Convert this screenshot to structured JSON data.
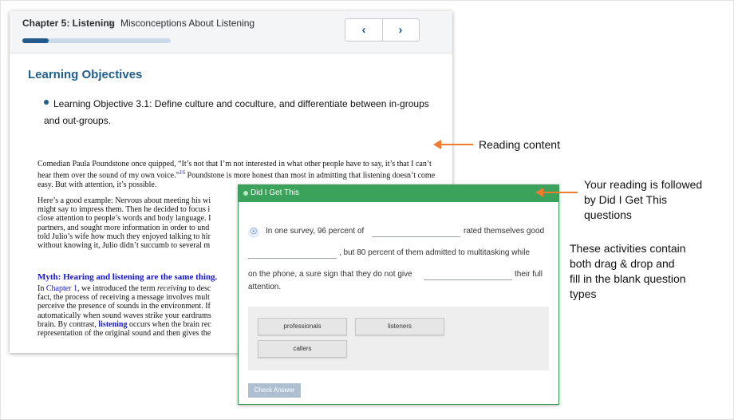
{
  "reader": {
    "chapter": "Chapter 5: Listening",
    "separator": ">",
    "section": "Misconceptions About Listening",
    "progress": 0.18,
    "prev_icon": "chevron-left-icon",
    "next_icon": "chevron-right-icon",
    "prev_glyph": "‹",
    "next_glyph": "›",
    "objectives_title": "Learning Objectives",
    "objective": "Learning Objective 3.1: Define culture and coculture, and differentiate between in-groups and out-groups.",
    "p1_a": "Comedian Paula Poundstone once quipped, “It’s not that I’m not interested in what other people have to say, it’s that I can’t hear them over the sound of my own voice.”",
    "p1_sup": "16",
    "p1_b": " Poundstone is more honest than most in admitting that listening doesn’t come easy. But with attention, it’s possible.",
    "p2": "Here’s a good example: Nervous about meeting his wi\nmight say to impress them. Then he decided to focus i\nclose attention to people’s words and body language. I\npartners, and sought more information in order to und\ntold Julio’s wife how much they enjoyed talking to hir\nwithout knowing it, Julio didn’t succumb to several m",
    "myth": "Myth: Hearing and listening are the same thing.",
    "p3_a": "In ",
    "p3_link": "Chapter 1",
    "p3_b": ", we introduced the term ",
    "p3_em": "receiving",
    "p3_c": " to desc\nfact, the process of receiving a message involves mult\nperceive the presence of sounds in the environment. If\nautomatically when sound waves strike your eardrums\nbrain. By contrast, ",
    "p3_bold": "listening",
    "p3_d": " occurs when the brain rec\nrepresentation of the original sound and then gives the"
  },
  "quiz": {
    "title": "Did I Get This",
    "accessibility_icon": "accessibility-icon",
    "seg1": "In one survey, 96 percent of",
    "seg2": "rated themselves good",
    "seg3": ", but 80 percent of them admitted to multitasking while",
    "seg4": "on the phone, a sure sign that they do not give",
    "seg5": "their full",
    "seg6": "attention.",
    "tiles": [
      "professionals",
      "listeners",
      "callers"
    ],
    "check_label": "Check Answer"
  },
  "annotations": {
    "reading": "Reading content",
    "dig": "Your reading is followed\nby Did I Get This\nquestions",
    "activities": "These activities contain\nboth drag & drop and\nfill in the blank question\ntypes",
    "arrow_color": "#ee7b2f"
  },
  "colors": {
    "accent_blue": "#1f5f8b",
    "quiz_green": "#3aa25a",
    "link_blue": "#1515d0"
  }
}
